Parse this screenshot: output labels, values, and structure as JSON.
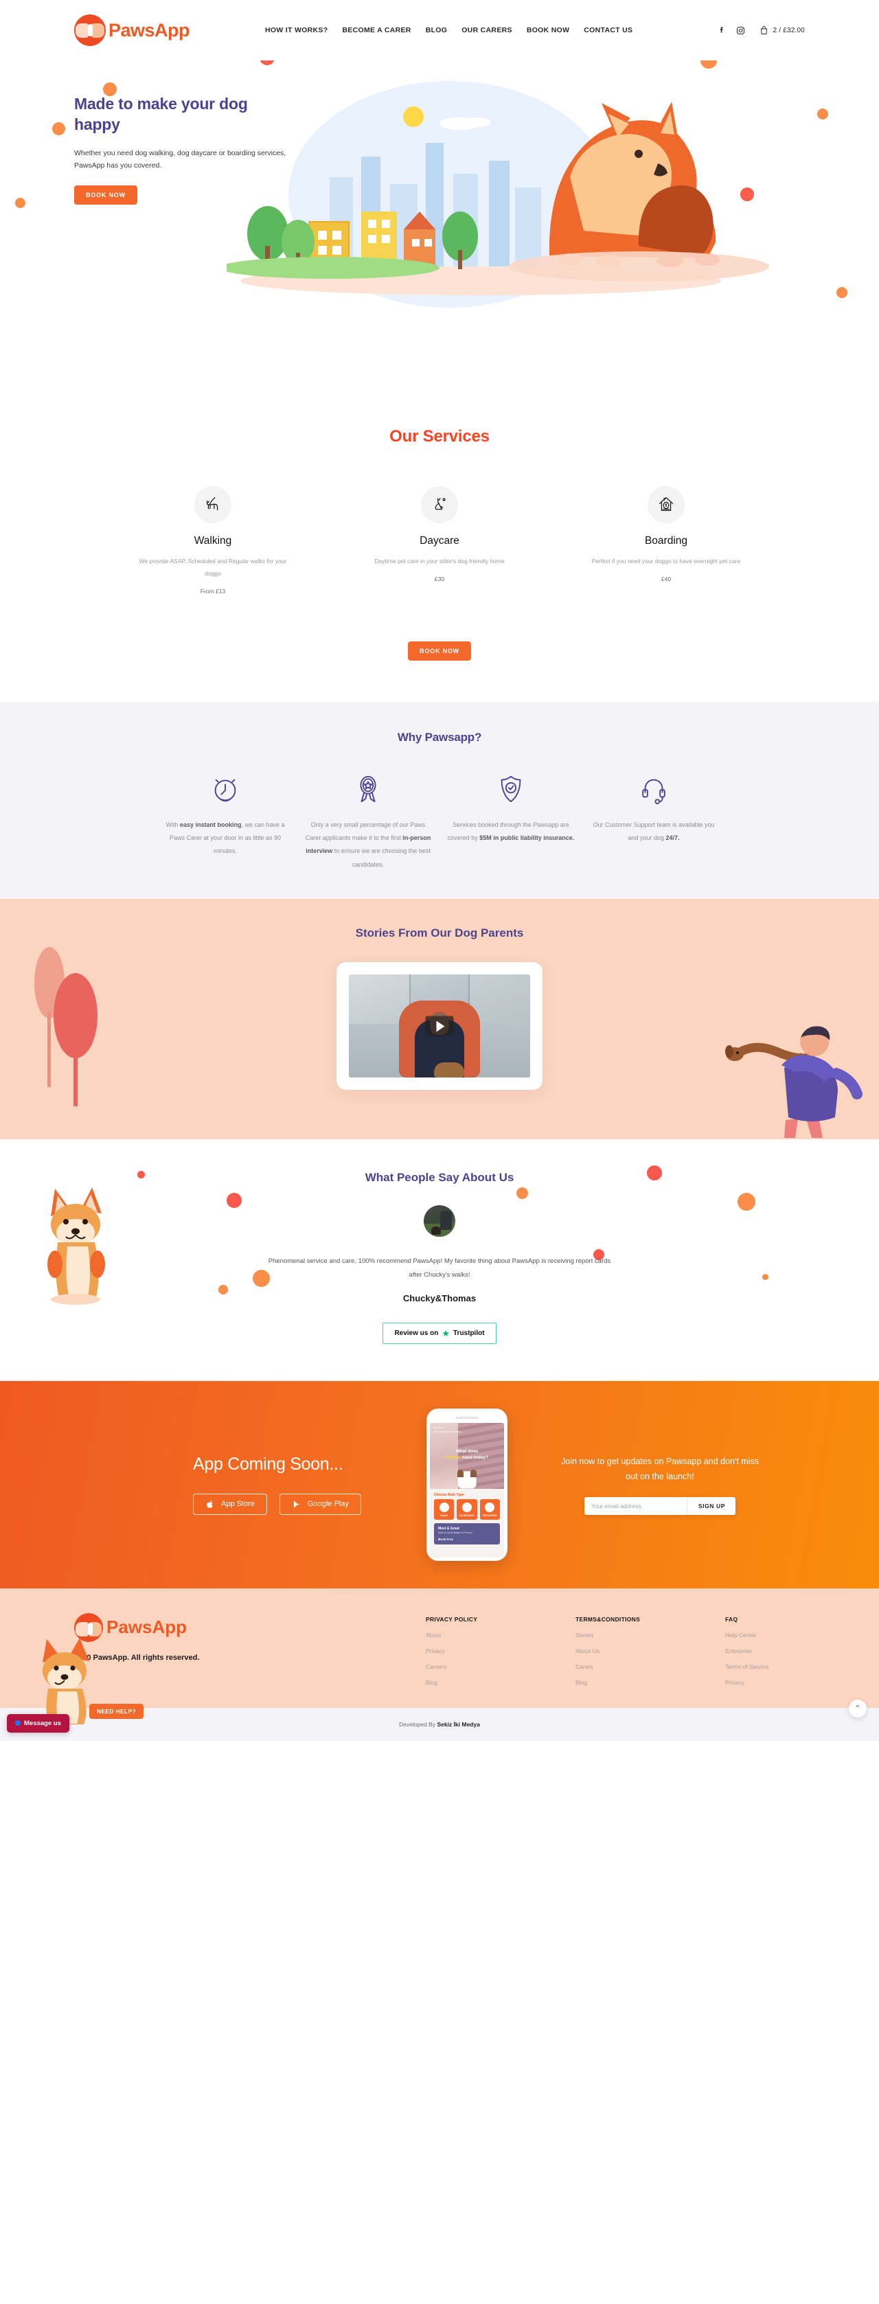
{
  "brand": {
    "name": "PawsApp",
    "orange": "#ef5a24",
    "purple": "#4b4391",
    "accent_red": "#f9441f"
  },
  "header": {
    "nav": [
      {
        "label": "HOW IT WORKS?"
      },
      {
        "label": "BECOME A CARER"
      },
      {
        "label": "BLOG"
      },
      {
        "label": "OUR CARERS"
      },
      {
        "label": "BOOK NOW"
      },
      {
        "label": "CONTACT US"
      }
    ],
    "social": [
      {
        "name": "facebook-icon"
      },
      {
        "name": "instagram-icon"
      }
    ],
    "cart": {
      "text": "2 / £32.00",
      "count": 2,
      "total": "£32.00"
    }
  },
  "hero": {
    "title": "Made to make your dog happy",
    "subtitle": "Whether you need dog walking, dog daycare or boarding services, PawsApp has you covered.",
    "cta": "BOOK NOW"
  },
  "services": {
    "title": "Our Services",
    "cta": "BOOK NOW",
    "items": [
      {
        "icon": "dog-walking-icon",
        "name": "Walking",
        "desc": "We provide ASAP, Scheduled and Regular walks for your doggo",
        "price": "From £13"
      },
      {
        "icon": "dog-sitting-icon",
        "name": "Daycare",
        "desc": "Daytime pet care in your sitter's dog-friendly home",
        "price": "£30"
      },
      {
        "icon": "dog-house-icon",
        "name": "Boarding",
        "desc": "Perfect if you need your doggo to have overnight pet care",
        "price": "£40"
      }
    ]
  },
  "why": {
    "title": "Why Pawsapp?",
    "items": [
      {
        "icon": "alarm-clock-icon",
        "pre": "With ",
        "bold": "easy instant booking",
        "post": ", we can have a Paws Carer at your door in as little as 90 minutes."
      },
      {
        "icon": "award-ribbon-icon",
        "pre": "Only a very small percentage of our Paws Carer applicants make it to the first ",
        "bold": "in-person interview",
        "post": " to ensure we are choosing the best candidates."
      },
      {
        "icon": "shield-check-icon",
        "pre": "Services booked through the Pawsapp are covered by ",
        "bold": "$5M in public liability insurance.",
        "post": ""
      },
      {
        "icon": "headset-icon",
        "pre": "Our Customer Support team is available you and your dog ",
        "bold": "24/7.",
        "post": ""
      }
    ]
  },
  "stories": {
    "title": "Stories From Our Dog Parents",
    "play_label": "play-video"
  },
  "testimonial": {
    "title": "What People Say About Us",
    "quote": "Phenomenal service and care, 100% recommend PawsApp! My favorite thing about PawsApp is receiving report cards after Chucky's walks!",
    "author": "Chucky&Thomas",
    "review_prefix": "Review us on",
    "review_brand": "Trustpilot",
    "review_star": "★"
  },
  "app": {
    "title": "App Coming Soon...",
    "stores": [
      {
        "icon": "apple-icon",
        "label": "App Store"
      },
      {
        "icon": "google-play-icon",
        "label": "Google Play"
      }
    ],
    "join_text": "Join now to get updates on Pawsapp and don't miss out on the launch!",
    "email_placeholder": "Your email address",
    "signup_label": "SIGN UP",
    "phone": {
      "location": "London,",
      "weather": "11C Cloudly and Rainy",
      "question_pre": "What does",
      "question_name": "Rambo",
      "question_post": "need today?",
      "choose_label": "Choose Walk Type",
      "walk_types": [
        {
          "label": "ASAP"
        },
        {
          "label": "SCHEDULE"
        },
        {
          "label": "RECURING"
        }
      ],
      "promo_title": "Meet & Great",
      "promo_sub": "Meet a Local Walker in Person!",
      "promo_cta": "Book Free"
    }
  },
  "footer": {
    "logo_text": "PawsApp",
    "copyright": "2020 PawsApp. All rights reserved.",
    "need_help": "NEED HELP?",
    "columns": [
      {
        "heading": "PRIVACY POLICY",
        "links": [
          "About",
          "Privacy",
          "Careers",
          "Blog"
        ]
      },
      {
        "heading": "TERMS&CONDITIONS",
        "links": [
          "Stories",
          "About Us",
          "Carers",
          "Blog"
        ]
      },
      {
        "heading": "FAQ",
        "links": [
          "Help Center",
          "Enterprise",
          "Terms of Service",
          "Privacy"
        ]
      }
    ]
  },
  "bottom": {
    "developed_pre": "Developed By ",
    "developed_by": "Sekiz İki Medya",
    "message_us": "Message us",
    "to_top": "⌃"
  }
}
